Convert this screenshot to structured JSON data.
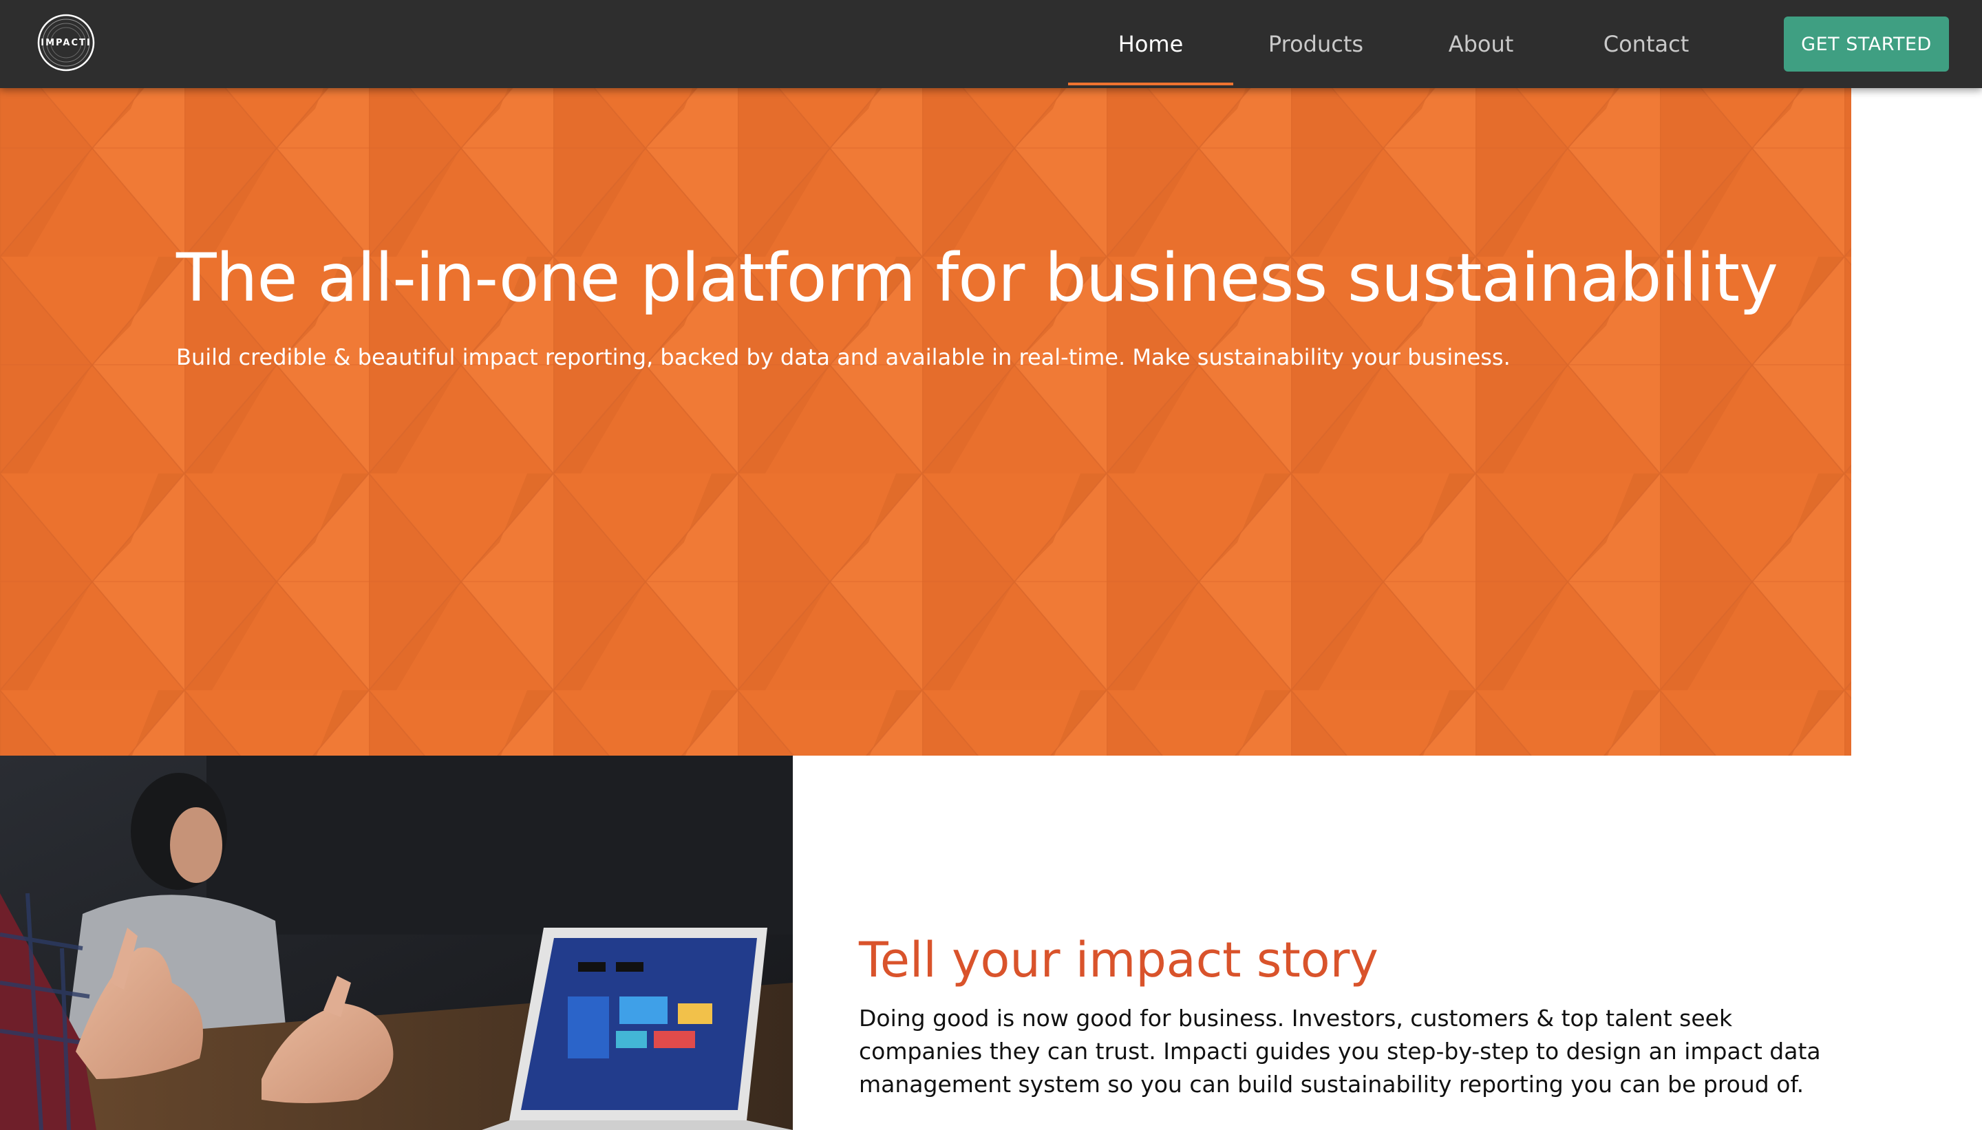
{
  "nav": {
    "logo_text": "IMPACTI",
    "links": [
      {
        "label": "Home",
        "active": true
      },
      {
        "label": "Products",
        "active": false
      },
      {
        "label": "About",
        "active": false
      },
      {
        "label": "Contact",
        "active": false
      }
    ],
    "cta_label": "GET STARTED"
  },
  "hero": {
    "title": "The all-in-one platform for business sustainability",
    "subtitle": "Build credible & beautiful impact reporting, backed by data and available in real-time. Make sustainability your business."
  },
  "story": {
    "title": "Tell your impact story",
    "body": "Doing good is now good for business. Investors, customers & top talent seek companies they can trust. Impacti guides you step-by-step to design an impact data management system so you can build sustainability reporting you can be proud of."
  },
  "colors": {
    "nav_background": "#2e2e2e",
    "hero_orange": "#ee7430",
    "active_underline": "#ee7430",
    "cta_green": "#3f9f82",
    "story_title": "#d9532b"
  },
  "icons": {
    "logo": "impacti-circle-logo"
  }
}
